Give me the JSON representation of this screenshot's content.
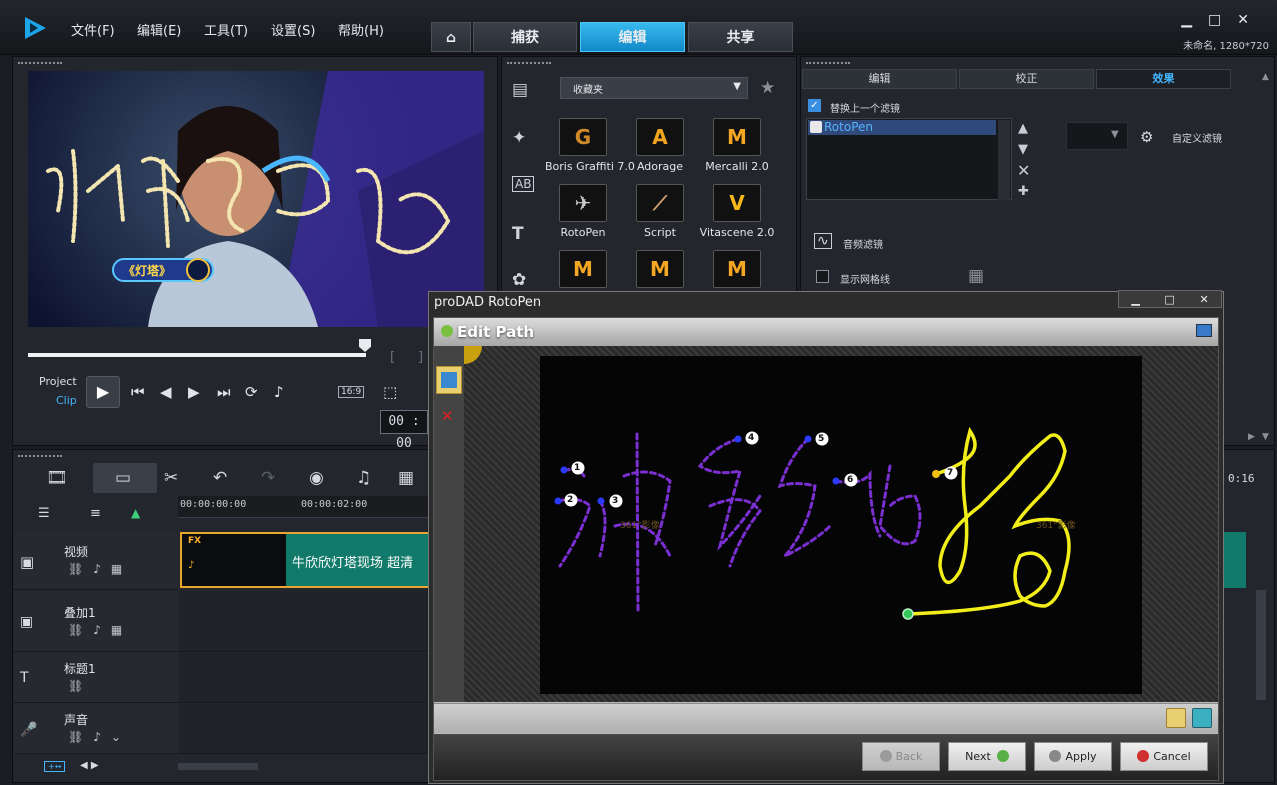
{
  "app": {
    "menu": [
      "文件(F)",
      "编辑(E)",
      "工具(T)",
      "设置(S)",
      "帮助(H)"
    ],
    "mode_tabs": [
      {
        "label": "捕获",
        "active": false
      },
      {
        "label": "编辑",
        "active": true
      },
      {
        "label": "共享",
        "active": false
      }
    ],
    "project_info": "未命名, 1280*720",
    "accent_color": "#1ea5e8"
  },
  "preview": {
    "overlay_text": "神彩飞扬",
    "badge_text": "《灯塔》",
    "project_label": "Project",
    "clip_label": "Clip",
    "aspect": "16:9",
    "timecode": "00 : 00"
  },
  "library": {
    "dropdown": "收藏夹",
    "effects": [
      {
        "name": "Boris Graffiti 7.0",
        "glyph": "G",
        "color": "#d08a2a"
      },
      {
        "name": "Adorage",
        "glyph": "A",
        "color": "#f2a520"
      },
      {
        "name": "Mercalli 2.0",
        "glyph": "M",
        "color": "#f5a623"
      },
      {
        "name": "RotoPen",
        "glyph": "✈",
        "color": "#c8c8c8"
      },
      {
        "name": "Script",
        "glyph": "⟋",
        "color": "#d0a070"
      },
      {
        "name": "Vitascene 2.0",
        "glyph": "V",
        "color": "#f5b81a"
      },
      {
        "name": "",
        "glyph": "M",
        "color": "#f5a623"
      },
      {
        "name": "",
        "glyph": "M",
        "color": "#f5a623"
      },
      {
        "name": "",
        "glyph": "M",
        "color": "#f5a623"
      }
    ]
  },
  "options": {
    "tabs": [
      {
        "label": "编辑",
        "active": false
      },
      {
        "label": "校正",
        "active": false
      },
      {
        "label": "效果",
        "active": true
      }
    ],
    "replace_filter_label": "替换上一个滤镜",
    "applied_filter": "RotoPen",
    "custom_filter_label": "自定义滤镜",
    "audio_filter_label": "音频滤镜",
    "show_grid_label": "显示网格线",
    "right_timecode": "0:16"
  },
  "timeline": {
    "ruler": [
      "00:00:00:00",
      "00:00:02:00"
    ],
    "tracks": [
      {
        "name": "视频",
        "icon": "video-track-icon"
      },
      {
        "name": "叠加1",
        "icon": "overlay-track-icon"
      },
      {
        "name": "标题1",
        "icon": "title-track-icon"
      },
      {
        "name": "声音",
        "icon": "voice-track-icon"
      }
    ],
    "clip_title": "牛欣欣灯塔现场 超清",
    "clip_fx": "FX"
  },
  "rotopen": {
    "window_title": "proDAD RotoPen",
    "panel_title": "Edit Path",
    "watermark": "361°影像",
    "points": [
      "1",
      "2",
      "3",
      "4",
      "5",
      "6",
      "7"
    ],
    "buttons": [
      {
        "label": "Back",
        "enabled": false
      },
      {
        "label": "Next",
        "enabled": true
      },
      {
        "label": "Apply",
        "enabled": true
      },
      {
        "label": "Cancel",
        "enabled": true
      }
    ],
    "path_purple": "#7a2fd0",
    "path_yellow": "#f2ee1a"
  }
}
